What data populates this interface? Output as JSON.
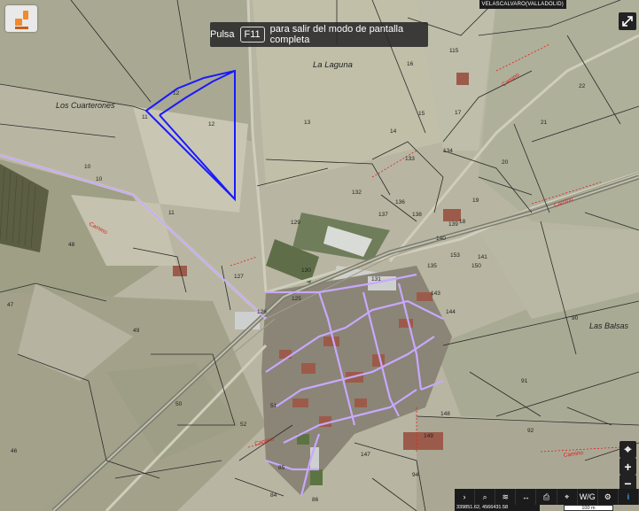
{
  "place_title": "VELASCALVARO(VALLADOLID)",
  "fullscreen_banner": {
    "prefix": "Pulsa",
    "key": "F11",
    "suffix": "para salir del modo de pantalla completa"
  },
  "place_names": {
    "la_laguna": "La Laguna",
    "los_cuarterones": "Los Cuarterones",
    "las_balsas": "Las Balsas"
  },
  "parcels": {
    "p12a": "12",
    "p12b": "12",
    "p11a": "11",
    "p10a": "10",
    "p10b": "10",
    "p11b": "11",
    "p48": "48",
    "p47": "47",
    "p49": "49",
    "p50": "50",
    "p46": "46",
    "p52": "52",
    "p51": "51",
    "p85": "85",
    "p84": "84",
    "p86": "86",
    "p147": "147",
    "p94": "94",
    "p149": "149",
    "p148": "148",
    "p92": "92",
    "p91": "91",
    "p90": "90",
    "p13": "13",
    "p14": "14",
    "p15": "15",
    "p16": "16",
    "p17": "17",
    "p115": "115",
    "p22": "22",
    "p21": "21",
    "p20": "20",
    "p19": "19",
    "p18": "18",
    "p133": "133",
    "p134": "134",
    "p132": "132",
    "p136": "136",
    "p137": "137",
    "p138": "138",
    "p139": "139",
    "p140": "140",
    "p141": "141",
    "p143": "143",
    "p144": "144",
    "p129": "129",
    "p130": "130",
    "p127": "127",
    "p126": "126",
    "p131": "131",
    "p125": "125",
    "p153": "153",
    "p150": "150",
    "p135": "135"
  },
  "road_labels": {
    "camino_w": "Camino",
    "camino_ne": "Camino",
    "camino_e": "Camino",
    "camino_s": "Camino",
    "camino_se": "Camino"
  },
  "toolbar": {
    "items": [
      {
        "name": "expand-arrow",
        "label": "›"
      },
      {
        "name": "search",
        "label": "⌕"
      },
      {
        "name": "layers",
        "label": "≋"
      },
      {
        "name": "measure",
        "label": "↔"
      },
      {
        "name": "print",
        "label": "⎙"
      },
      {
        "name": "pin",
        "label": "⌖"
      },
      {
        "name": "wms",
        "label": "W/G"
      },
      {
        "name": "tools",
        "label": "⚙"
      },
      {
        "name": "info",
        "label": "i"
      }
    ]
  },
  "coordinates": "339851.62, 4566431.58",
  "scale": "100 m",
  "controls": {
    "locate": "⌖",
    "zoom_in": "+",
    "zoom_out": "−"
  },
  "colors": {
    "parcel_line": "#2a2a2a",
    "highlight": "#1a1aff",
    "town": "#a67be0",
    "red_text": "#d22",
    "purple_road": "#c8a8ff"
  }
}
